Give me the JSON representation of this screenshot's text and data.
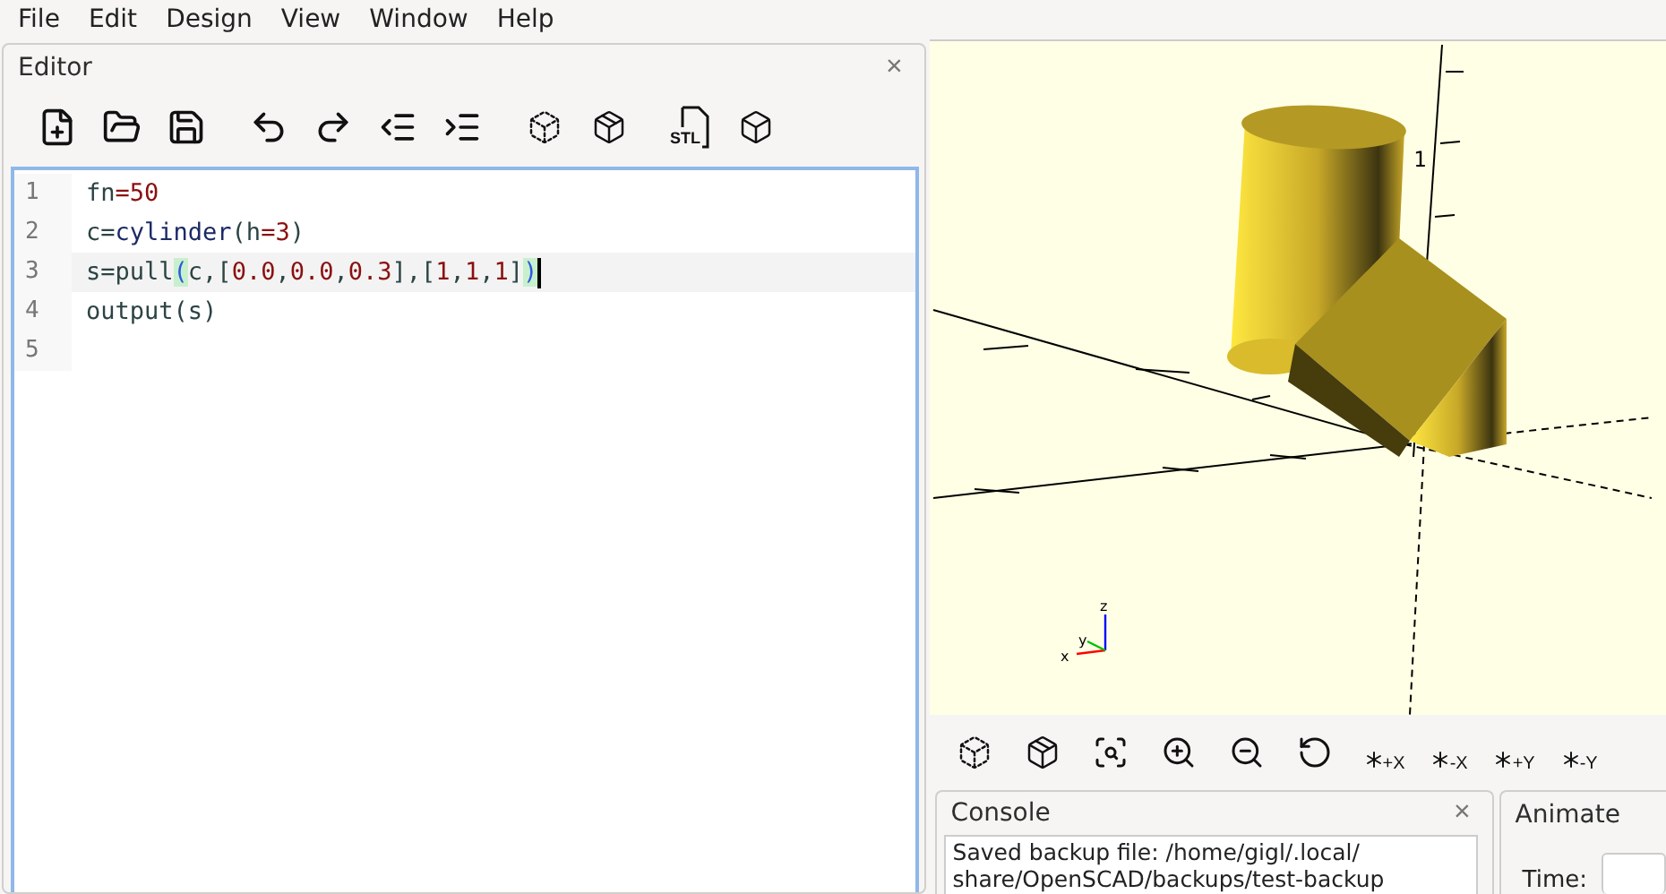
{
  "menu": [
    "File",
    "Edit",
    "Design",
    "View",
    "Window",
    "Help"
  ],
  "editor": {
    "title": "Editor",
    "close": "×",
    "toolbar_groups": [
      [
        {
          "kind": "new"
        },
        {
          "kind": "open"
        },
        {
          "kind": "save"
        }
      ],
      [
        {
          "kind": "undo"
        },
        {
          "kind": "redo"
        },
        {
          "kind": "unindent"
        },
        {
          "kind": "indent"
        }
      ],
      [
        {
          "kind": "preview"
        },
        {
          "kind": "render"
        }
      ],
      [
        {
          "kind": "stl",
          "label": "STL"
        },
        {
          "kind": "export"
        }
      ]
    ],
    "lines": [
      {
        "number": "1",
        "current": false,
        "tokens": [
          {
            "t": "fn",
            "kind": "id"
          },
          {
            "t": "=",
            "kind": "num"
          },
          {
            "t": "50",
            "kind": "num"
          }
        ]
      },
      {
        "number": "2",
        "current": false,
        "tokens": [
          {
            "t": "c=",
            "kind": "id"
          },
          {
            "t": "cylinder",
            "kind": "fn"
          },
          {
            "t": "(h",
            "kind": "id"
          },
          {
            "t": "=",
            "kind": "num"
          },
          {
            "t": "3",
            "kind": "num"
          },
          {
            "t": ")",
            "kind": "id"
          }
        ]
      },
      {
        "number": "3",
        "current": true,
        "tokens": [
          {
            "t": "s=pull",
            "kind": "id"
          },
          {
            "t": "(",
            "kind": "match"
          },
          {
            "t": "c,[",
            "kind": "id"
          },
          {
            "t": "0.0",
            "kind": "num"
          },
          {
            "t": ",",
            "kind": "id"
          },
          {
            "t": "0.0",
            "kind": "num"
          },
          {
            "t": ",",
            "kind": "id"
          },
          {
            "t": "0.3",
            "kind": "num"
          },
          {
            "t": "],[",
            "kind": "id"
          },
          {
            "t": "1",
            "kind": "num"
          },
          {
            "t": ",",
            "kind": "id"
          },
          {
            "t": "1",
            "kind": "num"
          },
          {
            "t": ",",
            "kind": "id"
          },
          {
            "t": "1",
            "kind": "num"
          },
          {
            "t": "]",
            "kind": "id"
          },
          {
            "t": ")",
            "kind": "match"
          }
        ]
      },
      {
        "number": "4",
        "current": false,
        "tokens": [
          {
            "t": "output(s)",
            "kind": "id"
          }
        ]
      },
      {
        "number": "5",
        "current": false
      }
    ]
  },
  "viewport": {
    "tick_label": "1",
    "axes": {
      "x": "x",
      "y": "y",
      "z": "z"
    }
  },
  "view_toolbar": [
    {
      "kind": "preview"
    },
    {
      "kind": "render"
    },
    {
      "kind": "fit"
    },
    {
      "kind": "zoom-in"
    },
    {
      "kind": "zoom-out"
    },
    {
      "kind": "reset"
    },
    {
      "kind": "axis",
      "label": "+X"
    },
    {
      "kind": "axis",
      "label": "-X"
    },
    {
      "kind": "axis",
      "label": "+Y"
    },
    {
      "kind": "axis",
      "label": "-Y"
    }
  ],
  "console": {
    "title": "Console",
    "close": "×",
    "lines": [
      "Saved backup file: /home/gigl/.local/",
      "share/OpenSCAD/backups/test-backup"
    ]
  },
  "animate": {
    "title": "Animate",
    "time_label": "Time:"
  }
}
